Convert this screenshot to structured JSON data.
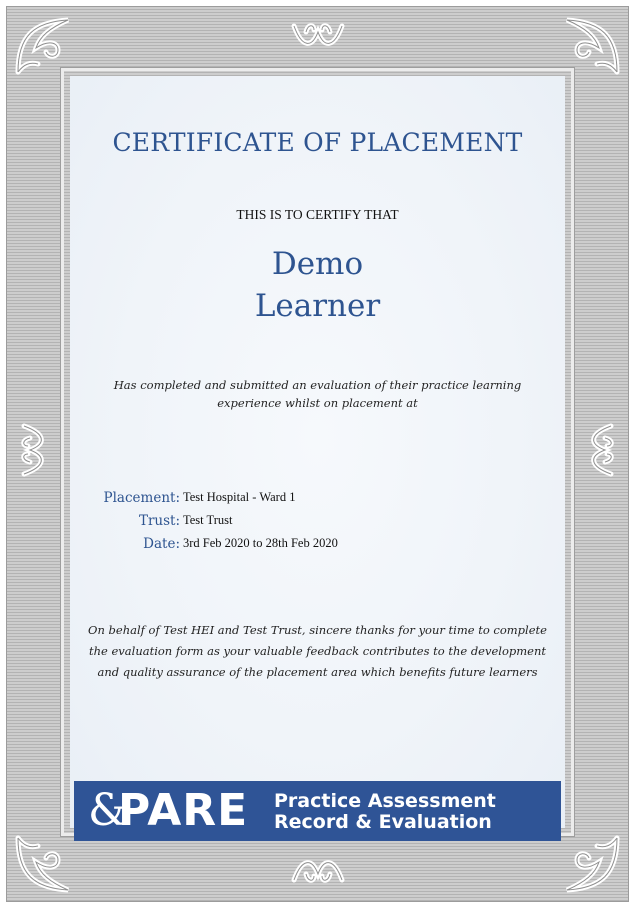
{
  "certificate": {
    "heading": "CERTIFICATE OF PLACEMENT",
    "certify_line": "THIS IS TO CERTIFY THAT",
    "learner_first_name": "Demo",
    "learner_last_name": "Learner",
    "statement": "Has completed and submitted an evaluation of their practice learning experience whilst on placement at",
    "details": {
      "placement_label": "Placement:",
      "placement_value": "Test Hospital - Ward 1",
      "trust_label": "Trust:",
      "trust_value": "Test Trust",
      "date_label": "Date:",
      "date_value": "3rd Feb 2020 to 28th Feb 2020"
    },
    "thanks": "On behalf of Test HEI and Test Trust, sincere thanks for your time to complete the evaluation form as your valuable feedback contributes to the development and quality assurance of the placement area which benefits future learners"
  },
  "logo": {
    "mark": "&",
    "name": "PARE",
    "subtitle_line1": "Practice Assessment",
    "subtitle_line2": "Record & Evaluation"
  },
  "colors": {
    "accent_blue": "#2e5490",
    "banner_blue": "#2f5496",
    "frame_grey": "#c2c2c2",
    "paper": "#f0f4f9"
  }
}
